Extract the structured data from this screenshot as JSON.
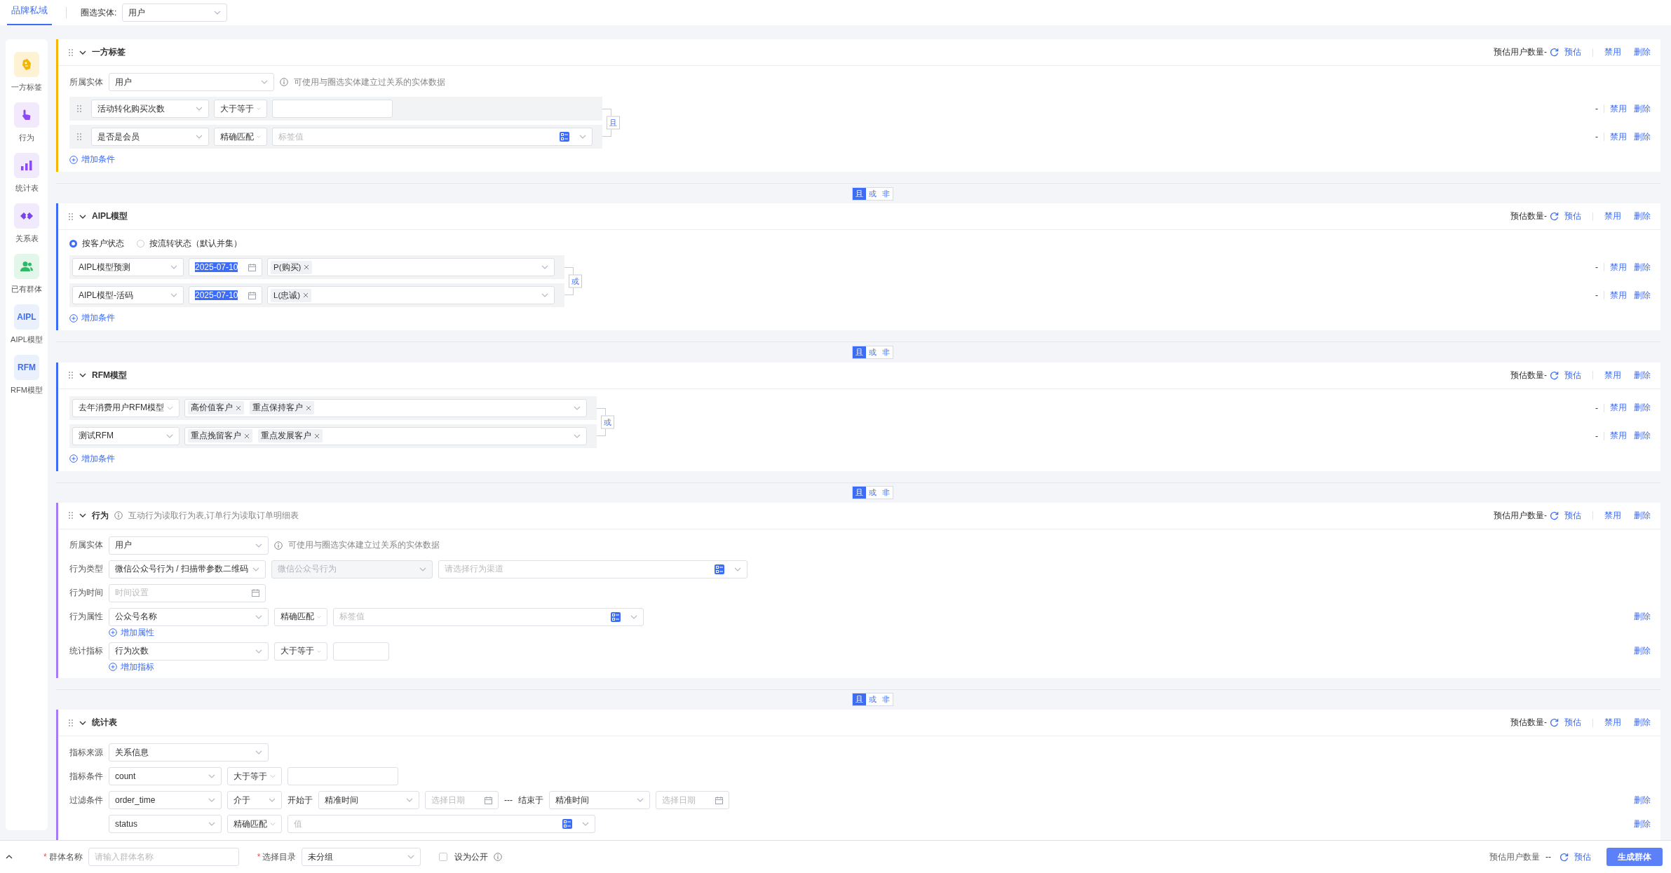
{
  "top_bar": {
    "tabs": [
      {
        "label": "品牌私域",
        "selected": true
      }
    ],
    "entity_label": "圈选实体:",
    "entity_value": "用户"
  },
  "sidebar": {
    "items": [
      {
        "kind": "tag",
        "label": "一方标签"
      },
      {
        "kind": "hand",
        "label": "行为"
      },
      {
        "kind": "bars",
        "label": "统计表"
      },
      {
        "kind": "link",
        "label": "关系表"
      },
      {
        "kind": "people",
        "label": "已有群体"
      },
      {
        "kind": "text",
        "icon_text": "AIPL",
        "label": "AIPL模型"
      },
      {
        "kind": "text",
        "icon_text": "RFM",
        "label": "RFM模型"
      }
    ]
  },
  "sections": [
    {
      "kind": "tag",
      "title": "一方标签",
      "estimate_label": "预估用户数量-",
      "estimate_link": "预估",
      "actions": [
        "禁用",
        "删除"
      ],
      "lines": [
        {
          "kind": "form",
          "label": "所属实体",
          "fields": [
            {
              "kind": "select",
              "value": "用户"
            }
          ],
          "hint": "可使用与圈选实体建立过关系的实体数据"
        },
        {
          "kind": "group",
          "joiner": "且",
          "handles": true,
          "rows": [
            {
              "fields": [
                {
                  "kind": "select",
                  "value": "活动转化购买次数"
                },
                {
                  "kind": "select",
                  "value": "大于等于"
                },
                {
                  "kind": "input"
                }
              ],
              "count": "-",
              "actions": [
                "禁用",
                "删除"
              ]
            },
            {
              "fields": [
                {
                  "kind": "select",
                  "value": "是否是会员"
                },
                {
                  "kind": "select",
                  "value": "精确匹配"
                },
                {
                  "kind": "picker",
                  "placeholder": "标签值"
                }
              ],
              "count": "-",
              "actions": [
                "禁用",
                "删除"
              ]
            }
          ]
        },
        {
          "kind": "add",
          "text": "增加条件"
        }
      ]
    },
    {
      "kind": "aipl",
      "title": "AIPL模型",
      "estimate_label": "预估数量-",
      "estimate_link": "预估",
      "actions": [
        "禁用",
        "删除"
      ],
      "connector": [
        {
          "label": "且",
          "selected": true
        },
        {
          "label": "或",
          "selected": false
        },
        {
          "label": "非",
          "selected": false
        }
      ],
      "lines": [
        {
          "kind": "radios",
          "options": [
            {
              "label": "按客户状态",
              "selected": true
            },
            {
              "label": "按流转状态（默认并集）",
              "selected": false
            }
          ]
        },
        {
          "kind": "group",
          "joiner": "或",
          "handles": false,
          "rows": [
            {
              "fields": [
                {
                  "kind": "select",
                  "value": "AIPL模型预测"
                },
                {
                  "kind": "date",
                  "value": "2025-07-10",
                  "highlighted": true
                },
                {
                  "kind": "tags",
                  "tags": [
                    "P(购买)"
                  ]
                }
              ],
              "count": "-",
              "actions": [
                "禁用",
                "删除"
              ]
            },
            {
              "fields": [
                {
                  "kind": "select",
                  "value": "AIPL模型-活码"
                },
                {
                  "kind": "date",
                  "value": "2025-07-10",
                  "highlighted": true
                },
                {
                  "kind": "tags",
                  "tags": [
                    "L(忠诚)"
                  ]
                }
              ],
              "count": "-",
              "actions": [
                "禁用",
                "删除"
              ]
            }
          ]
        },
        {
          "kind": "add",
          "text": "增加条件"
        }
      ]
    },
    {
      "kind": "rfm",
      "title": "RFM模型",
      "estimate_label": "预估数量-",
      "estimate_link": "预估",
      "actions": [
        "禁用",
        "删除"
      ],
      "connector": [
        {
          "label": "且",
          "selected": true
        },
        {
          "label": "或",
          "selected": false
        },
        {
          "label": "非",
          "selected": false
        }
      ],
      "lines": [
        {
          "kind": "group",
          "joiner": "或",
          "handles": false,
          "rows": [
            {
              "fields": [
                {
                  "kind": "select",
                  "value": "去年消费用户RFM模型"
                },
                {
                  "kind": "tags",
                  "tags": [
                    "高价值客户",
                    "重点保持客户"
                  ]
                }
              ],
              "count": "-",
              "actions": [
                "禁用",
                "删除"
              ]
            },
            {
              "fields": [
                {
                  "kind": "select",
                  "value": "测试RFM"
                },
                {
                  "kind": "tags",
                  "tags": [
                    "重点挽留客户",
                    "重点发展客户"
                  ]
                }
              ],
              "count": "-",
              "actions": [
                "禁用",
                "删除"
              ]
            }
          ]
        },
        {
          "kind": "add",
          "text": "增加条件"
        }
      ]
    },
    {
      "kind": "behavior",
      "title": "行为",
      "note": "互动行为读取行为表,订单行为读取订单明细表",
      "estimate_label": "预估用户数量-",
      "estimate_link": "预估",
      "actions": [
        "禁用",
        "删除"
      ],
      "connector": [
        {
          "label": "且",
          "selected": true
        },
        {
          "label": "或",
          "selected": false
        },
        {
          "label": "非",
          "selected": false
        }
      ],
      "lines": [
        {
          "kind": "form",
          "label": "所属实体",
          "fields": [
            {
              "kind": "select",
              "value": "用户"
            }
          ],
          "hint": "可使用与圈选实体建立过关系的实体数据"
        },
        {
          "kind": "form",
          "label": "行为类型",
          "fields": [
            {
              "kind": "select",
              "value": "微信公众号行为 / 扫描带参数二维码"
            },
            {
              "kind": "select",
              "value": "微信公众号行为",
              "disabled": true
            },
            {
              "kind": "picker",
              "placeholder": "请选择行为渠道"
            }
          ]
        },
        {
          "kind": "form",
          "label": "行为时间",
          "fields": [
            {
              "kind": "date",
              "placeholder": "时间设置"
            }
          ]
        },
        {
          "kind": "form",
          "label": "行为属性",
          "fields": [
            {
              "kind": "select",
              "value": "公众号名称"
            },
            {
              "kind": "select",
              "value": "精确匹配"
            },
            {
              "kind": "picker",
              "placeholder": "标签值"
            }
          ],
          "actions": [
            "删除"
          ]
        },
        {
          "kind": "link",
          "text": "增加属性"
        },
        {
          "kind": "form",
          "label": "统计指标",
          "fields": [
            {
              "kind": "select",
              "value": "行为次数"
            },
            {
              "kind": "select",
              "value": "大于等于"
            },
            {
              "kind": "input"
            }
          ],
          "actions": [
            "删除"
          ]
        },
        {
          "kind": "link",
          "text": "增加指标"
        }
      ]
    },
    {
      "kind": "stat",
      "title": "统计表",
      "estimate_label": "预估数量-",
      "estimate_link": "预估",
      "actions": [
        "禁用",
        "删除"
      ],
      "connector": [
        {
          "label": "且",
          "selected": true
        },
        {
          "label": "或",
          "selected": false
        },
        {
          "label": "非",
          "selected": false
        }
      ],
      "lines": [
        {
          "kind": "form",
          "label": "指标来源",
          "fields": [
            {
              "kind": "select",
              "value": "关系信息"
            }
          ]
        },
        {
          "kind": "form",
          "label": "指标条件",
          "fields": [
            {
              "kind": "select",
              "value": "count"
            },
            {
              "kind": "select",
              "value": "大于等于"
            },
            {
              "kind": "input"
            }
          ]
        },
        {
          "kind": "form",
          "label": "过滤条件",
          "fields": [
            {
              "kind": "select",
              "value": "order_time"
            },
            {
              "kind": "select",
              "value": "介于"
            },
            {
              "kind": "text",
              "value": "开始于"
            },
            {
              "kind": "select",
              "value": "精准时间"
            },
            {
              "kind": "date",
              "placeholder": "选择日期"
            },
            {
              "kind": "text",
              "value": "---"
            },
            {
              "kind": "text",
              "value": "结束于"
            },
            {
              "kind": "select",
              "value": "精准时间"
            },
            {
              "kind": "date",
              "placeholder": "选择日期"
            }
          ],
          "actions": [
            "删除"
          ]
        },
        {
          "kind": "form",
          "fields": [
            {
              "kind": "select",
              "value": "status"
            },
            {
              "kind": "select",
              "value": "精确匹配"
            },
            {
              "kind": "picker",
              "placeholder": "值"
            }
          ],
          "actions": [
            "删除"
          ]
        }
      ]
    }
  ],
  "footer": {
    "fields": [
      {
        "kind": "input",
        "required_mark": "*",
        "label": "群体名称",
        "placeholder": "请输入群体名称"
      },
      {
        "kind": "select",
        "required_mark": "*",
        "label": "选择目录",
        "value": "未分组"
      }
    ],
    "public_checkbox": {
      "label": "设为公开",
      "checked": false
    },
    "estimate_label": "预估用户数量",
    "estimate_value": "--",
    "estimate_link": "预估",
    "submit": "生成群体"
  }
}
